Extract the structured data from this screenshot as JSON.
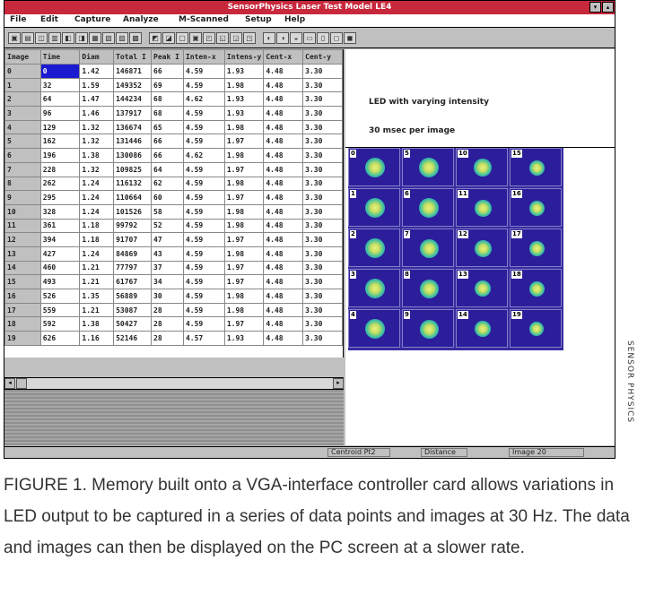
{
  "window": {
    "title": "SensorPhysics Laser Test Model LE4",
    "buttons": [
      "▾",
      "▴"
    ]
  },
  "menu": [
    "File",
    "Edit",
    "Capture",
    "Analyze",
    "M-Scanned",
    "Setup",
    "Help"
  ],
  "grid": {
    "columns": [
      "Image",
      "Time",
      "Diam",
      "Total I",
      "Peak I",
      "Inten-x",
      "Intens-y",
      "Cent-x",
      "Cent-y"
    ],
    "rows": [
      [
        "0",
        "0",
        "1.42",
        "146871",
        "66",
        "4.59",
        "1.93",
        "4.48",
        "3.30"
      ],
      [
        "1",
        "32",
        "1.59",
        "149352",
        "69",
        "4.59",
        "1.98",
        "4.48",
        "3.30"
      ],
      [
        "2",
        "64",
        "1.47",
        "144234",
        "68",
        "4.62",
        "1.93",
        "4.48",
        "3.30"
      ],
      [
        "3",
        "96",
        "1.46",
        "137917",
        "68",
        "4.59",
        "1.93",
        "4.48",
        "3.30"
      ],
      [
        "4",
        "129",
        "1.32",
        "136674",
        "65",
        "4.59",
        "1.98",
        "4.48",
        "3.30"
      ],
      [
        "5",
        "162",
        "1.32",
        "131446",
        "66",
        "4.59",
        "1.97",
        "4.48",
        "3.30"
      ],
      [
        "6",
        "196",
        "1.38",
        "130086",
        "66",
        "4.62",
        "1.98",
        "4.48",
        "3.30"
      ],
      [
        "7",
        "228",
        "1.32",
        "109825",
        "64",
        "4.59",
        "1.97",
        "4.48",
        "3.30"
      ],
      [
        "8",
        "262",
        "1.24",
        "116132",
        "62",
        "4.59",
        "1.98",
        "4.48",
        "3.30"
      ],
      [
        "9",
        "295",
        "1.24",
        "110664",
        "60",
        "4.59",
        "1.97",
        "4.48",
        "3.30"
      ],
      [
        "10",
        "328",
        "1.24",
        "101526",
        "58",
        "4.59",
        "1.98",
        "4.48",
        "3.30"
      ],
      [
        "11",
        "361",
        "1.18",
        "99792",
        "52",
        "4.59",
        "1.98",
        "4.48",
        "3.30"
      ],
      [
        "12",
        "394",
        "1.18",
        "91707",
        "47",
        "4.59",
        "1.97",
        "4.48",
        "3.30"
      ],
      [
        "13",
        "427",
        "1.24",
        "84869",
        "43",
        "4.59",
        "1.98",
        "4.48",
        "3.30"
      ],
      [
        "14",
        "460",
        "1.21",
        "77797",
        "37",
        "4.59",
        "1.97",
        "4.48",
        "3.30"
      ],
      [
        "15",
        "493",
        "1.21",
        "61767",
        "34",
        "4.59",
        "1.97",
        "4.48",
        "3.30"
      ],
      [
        "16",
        "526",
        "1.35",
        "56889",
        "30",
        "4.59",
        "1.98",
        "4.48",
        "3.30"
      ],
      [
        "17",
        "559",
        "1.21",
        "53087",
        "28",
        "4.59",
        "1.98",
        "4.48",
        "3.30"
      ],
      [
        "18",
        "592",
        "1.38",
        "50427",
        "28",
        "4.59",
        "1.97",
        "4.48",
        "3.30"
      ],
      [
        "19",
        "626",
        "1.16",
        "52146",
        "28",
        "4.57",
        "1.93",
        "4.48",
        "3.30"
      ]
    ]
  },
  "info": {
    "line1": "LED  with varying intensity",
    "line2": "30 msec per image"
  },
  "thumbnails": {
    "labels": [
      "0",
      "5",
      "10",
      "15",
      "1",
      "6",
      "11",
      "16",
      "2",
      "7",
      "12",
      "17",
      "3",
      "8",
      "13",
      "18",
      "4",
      "9",
      "14",
      "19"
    ],
    "spot_intensity": [
      1.0,
      0.98,
      0.8,
      0.6,
      1.0,
      0.96,
      0.78,
      0.58,
      0.98,
      0.94,
      0.74,
      0.56,
      0.98,
      0.92,
      0.7,
      0.55,
      0.97,
      0.9,
      0.66,
      0.54
    ]
  },
  "status": {
    "centroid": "Centroid  Pt2",
    "distance": "Distance",
    "image": "Image    20"
  },
  "credit": "SENSOR PHYSICS",
  "caption": "FIGURE 1. Memory built onto a VGA-interface controller card allows variations in LED output to be captured in a series of data points and images at 30 Hz. The data and images can then be displayed on the PC screen at a slower rate."
}
